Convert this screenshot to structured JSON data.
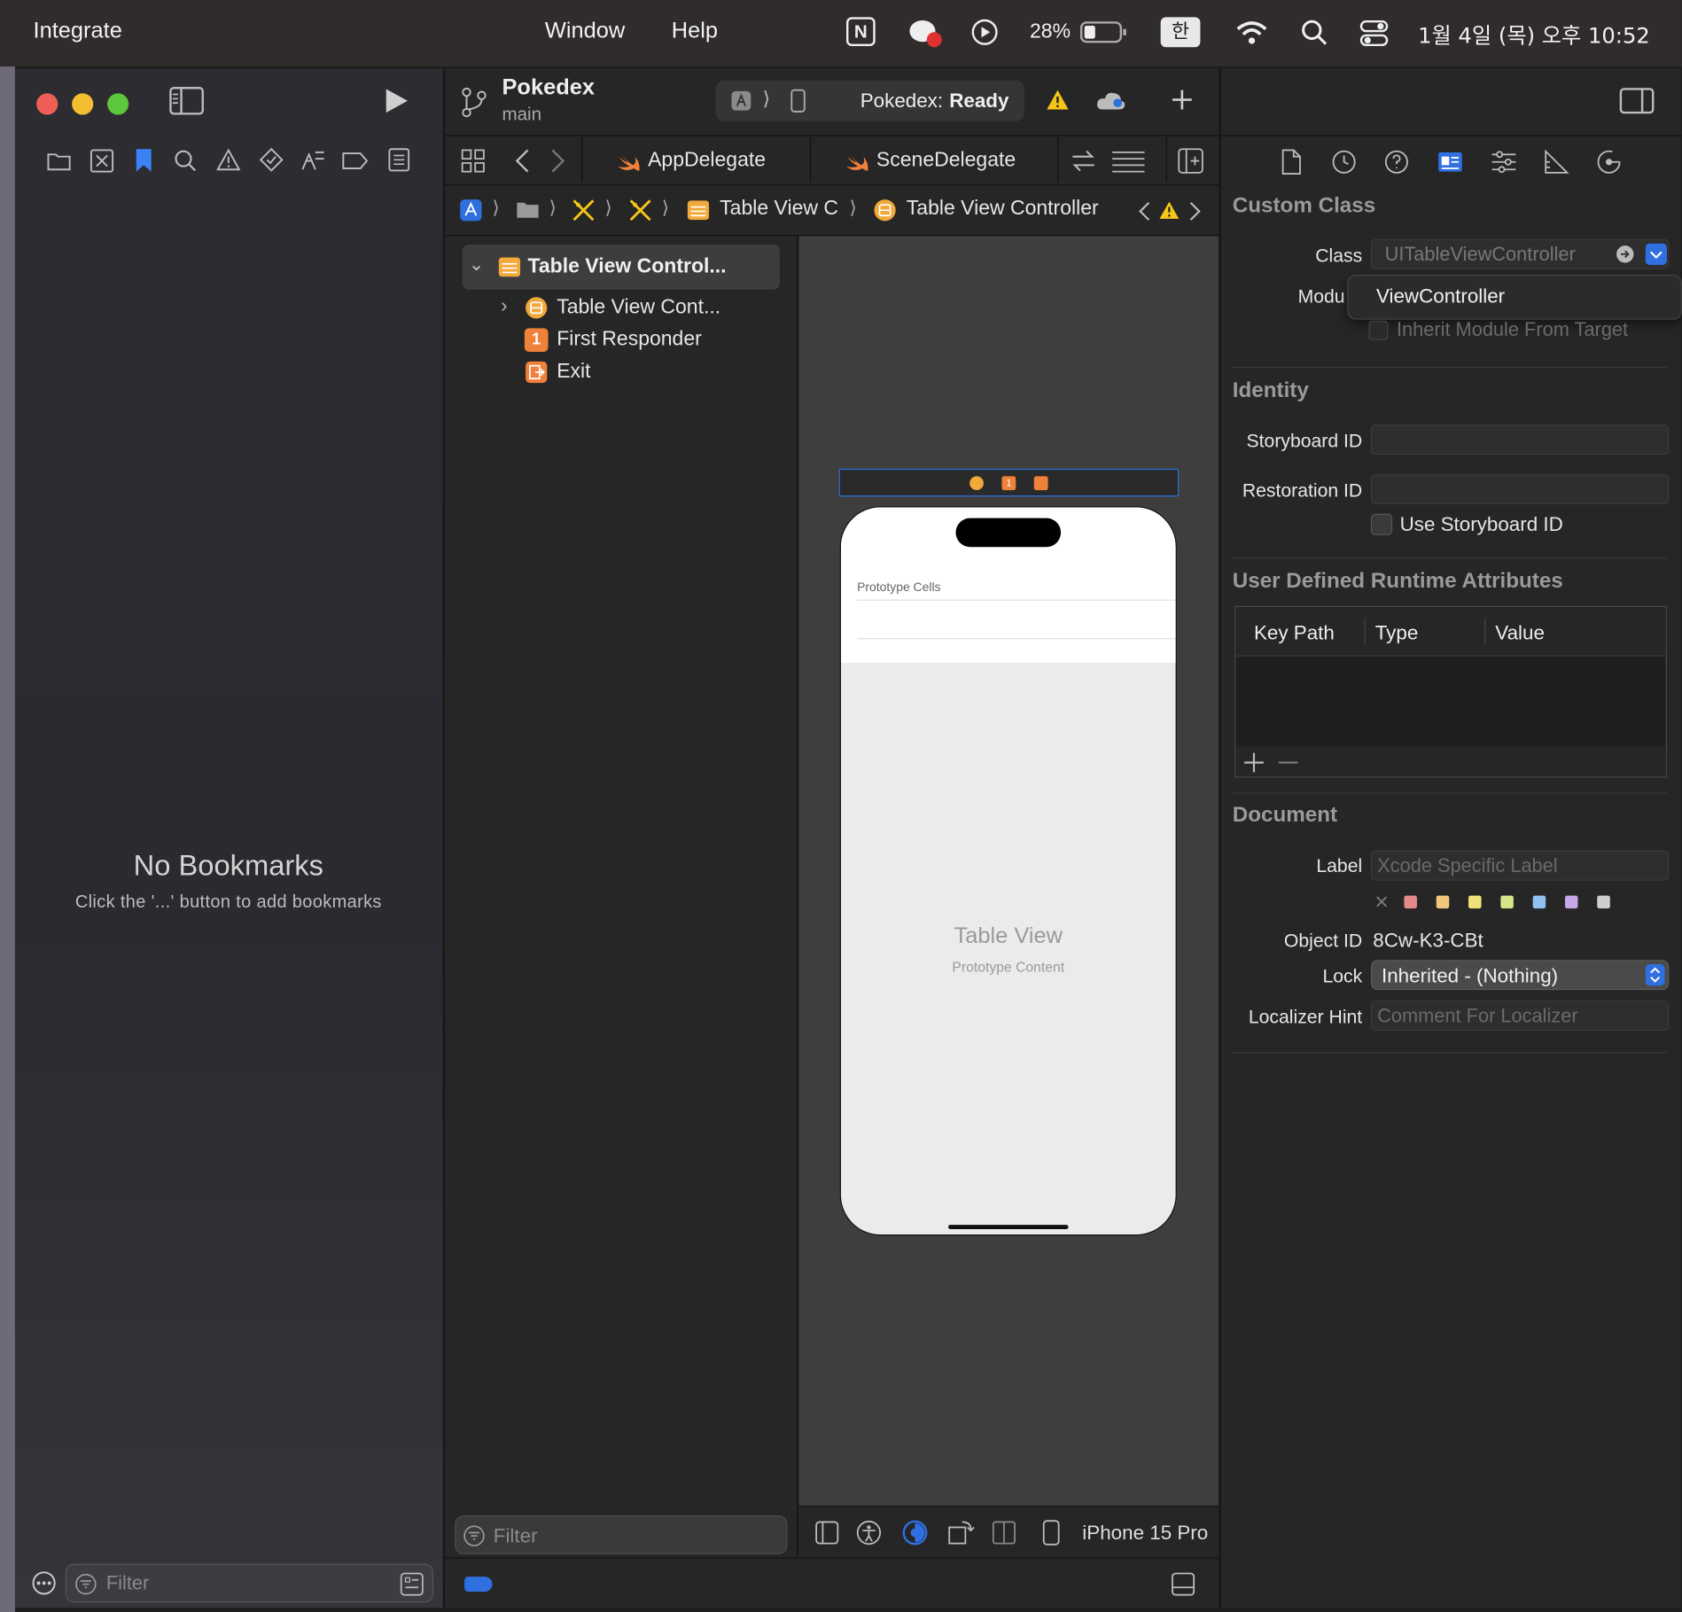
{
  "menubar": {
    "app": "Integrate",
    "window": "Window",
    "help": "Help",
    "battery": "28%",
    "ime": "한",
    "clock": "1월 4일 (목) 오후 10:52"
  },
  "sidebar": {
    "empty_title": "No Bookmarks",
    "empty_hint": "Click the '...' button to add bookmarks",
    "filter_placeholder": "Filter"
  },
  "toolbar": {
    "project": "Pokedex",
    "branch": "main",
    "status_name": "Pokedex:",
    "status_state": "Ready"
  },
  "tabs": [
    "AppDelegate",
    "SceneDelegate"
  ],
  "breadcrumb": {
    "item1": "Table View C",
    "item2": "Table View Controller"
  },
  "outline": {
    "root": "Table View Control...",
    "child1": "Table View Cont...",
    "child2": "First Responder",
    "child3": "Exit",
    "badge_responder": "1",
    "filter_placeholder": "Filter"
  },
  "canvas": {
    "prototype_cells": "Prototype Cells",
    "table_view": "Table View",
    "prototype_content": "Prototype Content",
    "device": "iPhone 15 Pro",
    "badge": "1"
  },
  "inspector": {
    "custom_class": {
      "heading": "Custom Class",
      "class_label": "Class",
      "class_value": "UITableViewController",
      "module_label": "Modu",
      "module_popup": "ViewController",
      "inherit_label": "Inherit Module From Target"
    },
    "identity": {
      "heading": "Identity",
      "storyboard_label": "Storyboard ID",
      "restoration_label": "Restoration ID",
      "use_storyboard": "Use Storyboard ID"
    },
    "runtime": {
      "heading": "User Defined Runtime Attributes",
      "col_keypath": "Key Path",
      "col_type": "Type",
      "col_value": "Value"
    },
    "document": {
      "heading": "Document",
      "label_label": "Label",
      "label_placeholder": "Xcode Specific Label",
      "objectid_label": "Object ID",
      "objectid_value": "8Cw-K3-CBt",
      "lock_label": "Lock",
      "lock_value": "Inherited - (Nothing)",
      "hint_label": "Localizer Hint",
      "hint_placeholder": "Comment For Localizer"
    }
  },
  "colors": {
    "accent": "#2f6fe0",
    "warning": "#f5c518",
    "swift": "#f0813a",
    "outline_icon": "#f2a93b"
  },
  "swatch_colors": [
    "#e58989",
    "#f2c57c",
    "#efe27b",
    "#d6e58a",
    "#8fc2f2",
    "#c9a6ea",
    "#cfcfcf"
  ]
}
